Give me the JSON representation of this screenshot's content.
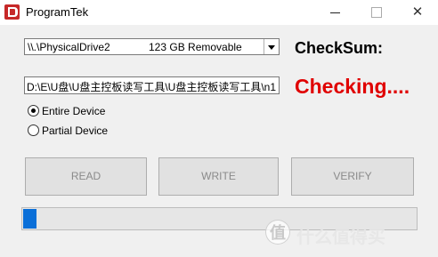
{
  "window": {
    "title": "ProgramTek"
  },
  "icons": {
    "app": "programtek-logo-icon",
    "minimize": "minimize-icon",
    "maximize": "maximize-icon",
    "close": "close-icon",
    "dropdown": "chevron-down-icon"
  },
  "drive_select": {
    "path": "\\\\.\\PhysicalDrive2",
    "info": "123 GB Removable"
  },
  "checksum": {
    "label": "CheckSum:"
  },
  "file_path": {
    "value": "D:\\E\\U盘\\U盘主控板读写工具\\U盘主控板读写工具\\n1"
  },
  "status": {
    "text": "Checking....",
    "color": "#e00000"
  },
  "mode": {
    "options": [
      {
        "label": "Entire Device",
        "checked": true
      },
      {
        "label": "Partial Device",
        "checked": false
      }
    ]
  },
  "buttons": {
    "read": "READ",
    "write": "WRITE",
    "verify": "VERIFY"
  },
  "progress": {
    "fraction": 0.03,
    "color": "#0a6fd8"
  },
  "watermark": {
    "badge": "值",
    "text": "什么值得买"
  }
}
